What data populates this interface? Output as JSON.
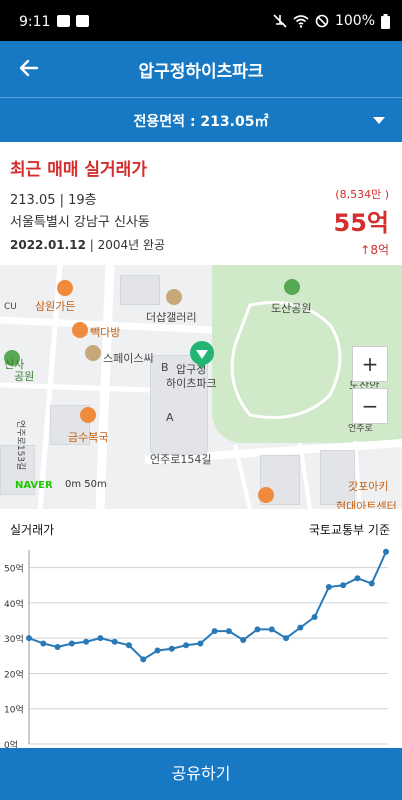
{
  "status": {
    "time": "9:11",
    "battery": "100%"
  },
  "header": {
    "title": "압구정하이츠파크"
  },
  "area": {
    "label": "전용면적 : 213.05㎡"
  },
  "trade": {
    "heading": "최근 매매 실거래가",
    "line1": "213.05 | 19층",
    "address": "서울특별시 강남구 신사동",
    "date": "2022.01.12",
    "built": " | 2004년 완공",
    "unit_price": "(8,534만 )",
    "price": "55억",
    "delta": "↑8억"
  },
  "map": {
    "labels": {
      "samwon": "삼원가든",
      "bakdabang": "빽다방",
      "spacec": "스페이스씨",
      "dobsan_park": "도산공원",
      "theshop": "더샵갤러리",
      "apt_a": "압구정",
      "apt_b": "하이츠파크",
      "sinsa": "신사",
      "neighborhood": "공원",
      "geumsu": "금수복국",
      "road154": "언주로154길",
      "road153": "언주로153길",
      "dosan_mem": "도산안",
      "dosan_mem2": "기념",
      "gatpo": "갓포아키",
      "hyundai": "현대아트센터",
      "road_side": "언주로",
      "cu": "CU",
      "block_a": "A",
      "block_b": "B"
    },
    "naver": "NAVER",
    "scale": "0m      50m",
    "zoom_in": "+",
    "zoom_out": "−"
  },
  "chart_section": {
    "title": "실거래가",
    "source": "국토교통부 기준"
  },
  "chart_data": {
    "type": "line",
    "title": "",
    "xlabel": "",
    "ylabel": "",
    "ylim": [
      0,
      55
    ],
    "yticks": [
      "0억",
      "10억",
      "20억",
      "30억",
      "40억",
      "50억"
    ],
    "series": [
      {
        "name": "",
        "color": "#2a79b7",
        "values": [
          30,
          28.5,
          27.5,
          28.5,
          29,
          30,
          29,
          28,
          24,
          26.5,
          27,
          28,
          28.5,
          32,
          32,
          29.5,
          32.5,
          32.5,
          30,
          33,
          36,
          44.5,
          45,
          47,
          45.5,
          54.5
        ]
      }
    ]
  },
  "share": {
    "label": "공유하기"
  },
  "colors": {
    "primary": "#1778c3",
    "accent": "#d32f2f",
    "park": "#cfe9c9",
    "pin": "#22b573"
  }
}
